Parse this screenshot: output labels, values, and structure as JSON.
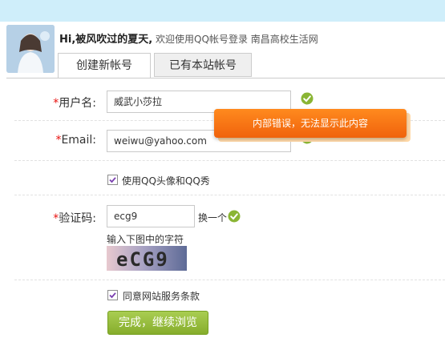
{
  "header": {
    "user_name": "Hi,被风吹过的夏天,",
    "welcome": "欢迎使用QQ帐号登录 南昌高校生活网"
  },
  "tabs": [
    {
      "label": "创建新帐号",
      "active": true
    },
    {
      "label": "已有本站帐号",
      "active": false
    }
  ],
  "form": {
    "username": {
      "required_mark": "*",
      "label": "用户名:",
      "value": "威武小莎拉"
    },
    "email": {
      "required_mark": "*",
      "label": "Email:",
      "value": "weiwu@yahoo.com"
    },
    "use_avatar": {
      "label": "使用QQ头像和QQ秀",
      "checked": true
    },
    "captcha": {
      "required_mark": "*",
      "label": "验证码:",
      "value": "ecg9",
      "change_label": "换一个",
      "hint": "输入下图中的字符",
      "image_text": "eCG9"
    },
    "agree": {
      "label": "同意网站服务条款",
      "checked": true
    },
    "submit_label": "完成，继续浏览"
  },
  "error_popup": {
    "text": "内部错误，无法显示此内容"
  },
  "colors": {
    "accent_green": "#8ab534",
    "required_red": "#e8110f",
    "error_orange": "#f0620c",
    "topbar": "#cfeefa"
  }
}
